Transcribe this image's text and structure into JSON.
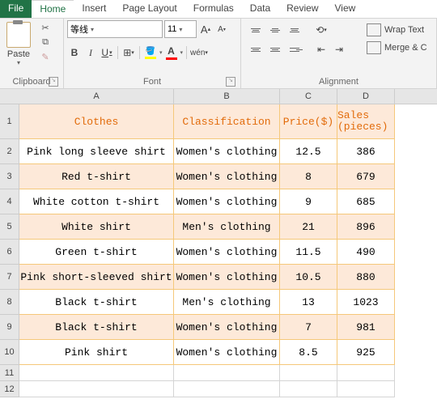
{
  "tabs": {
    "file": "File",
    "home": "Home",
    "insert": "Insert",
    "pageLayout": "Page Layout",
    "formulas": "Formulas",
    "data": "Data",
    "review": "Review",
    "view": "View"
  },
  "ribbon": {
    "paste": "Paste",
    "clipboard": "Clipboard",
    "fontName": "等线",
    "fontSize": "11",
    "fontGroup": "Font",
    "alignGroup": "Alignment",
    "wrap": "Wrap Text",
    "merge": "Merge & C"
  },
  "cols": {
    "A": "A",
    "B": "B",
    "C": "C",
    "D": "D"
  },
  "colWidths": {
    "A": 190,
    "B": 130,
    "C": 70,
    "D": 70
  },
  "rowH": {
    "hdr": 42,
    "data": 30,
    "empty": 19
  },
  "headers": {
    "clothes": "Clothes",
    "class": "Classification",
    "price": "Price($)",
    "sales": "Sales (pieces)"
  },
  "rows": [
    {
      "n": "2",
      "clothes": "Pink long sleeve shirt",
      "class": "Women's clothing",
      "price": "12.5",
      "sales": "386"
    },
    {
      "n": "3",
      "clothes": "Red t-shirt",
      "class": "Women's clothing",
      "price": "8",
      "sales": "679"
    },
    {
      "n": "4",
      "clothes": "White cotton t-shirt",
      "class": "Women's clothing",
      "price": "9",
      "sales": "685"
    },
    {
      "n": "5",
      "clothes": "White shirt",
      "class": "Men's clothing",
      "price": "21",
      "sales": "896"
    },
    {
      "n": "6",
      "clothes": "Green t-shirt",
      "class": "Women's clothing",
      "price": "11.5",
      "sales": "490"
    },
    {
      "n": "7",
      "clothes": "Pink short-sleeved shirt",
      "class": "Women's clothing",
      "price": "10.5",
      "sales": "880"
    },
    {
      "n": "8",
      "clothes": "Black t-shirt",
      "class": "Men's clothing",
      "price": "13",
      "sales": "1023"
    },
    {
      "n": "9",
      "clothes": "Black t-shirt",
      "class": "Women's clothing",
      "price": "7",
      "sales": "981"
    },
    {
      "n": "10",
      "clothes": "Pink shirt",
      "class": "Women's clothing",
      "price": "8.5",
      "sales": "925"
    }
  ],
  "chart_data": {
    "type": "table",
    "title": "Clothes sales",
    "columns": [
      "Clothes",
      "Classification",
      "Price($)",
      "Sales (pieces)"
    ],
    "data": [
      [
        "Pink long sleeve shirt",
        "Women's clothing",
        12.5,
        386
      ],
      [
        "Red t-shirt",
        "Women's clothing",
        8,
        679
      ],
      [
        "White cotton t-shirt",
        "Women's clothing",
        9,
        685
      ],
      [
        "White shirt",
        "Men's clothing",
        21,
        896
      ],
      [
        "Green t-shirt",
        "Women's clothing",
        11.5,
        490
      ],
      [
        "Pink short-sleeved shirt",
        "Women's clothing",
        10.5,
        880
      ],
      [
        "Black t-shirt",
        "Men's clothing",
        13,
        1023
      ],
      [
        "Black t-shirt",
        "Women's clothing",
        7,
        981
      ],
      [
        "Pink shirt",
        "Women's clothing",
        8.5,
        925
      ]
    ]
  }
}
